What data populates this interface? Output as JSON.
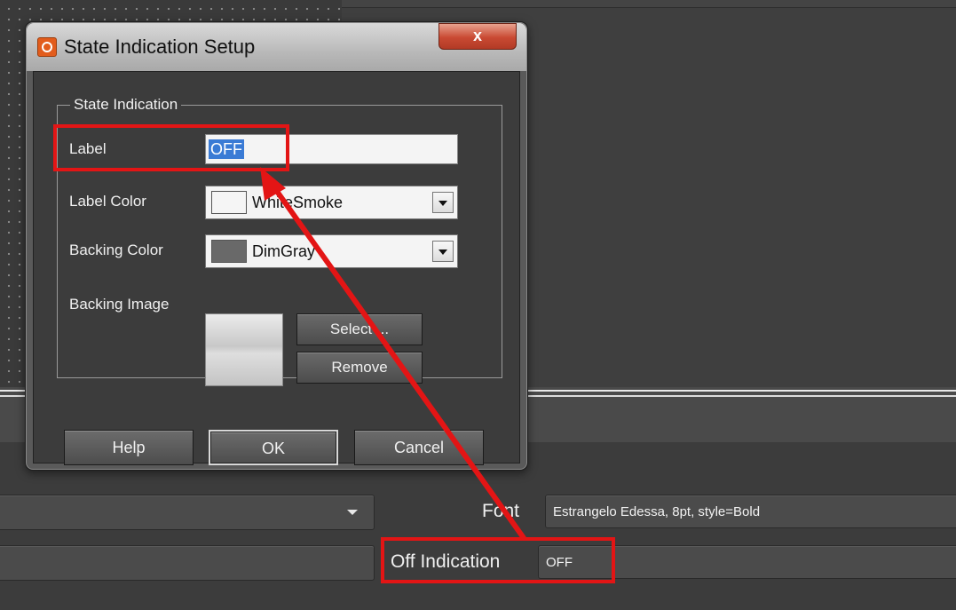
{
  "dialog": {
    "title": "State Indication Setup",
    "close_glyph": "x",
    "group_title": "State Indication",
    "label_field": {
      "label": "Label",
      "value": "OFF"
    },
    "label_color": {
      "label": "Label Color",
      "value": "WhiteSmoke",
      "swatch": "#f5f5f5"
    },
    "backing_color": {
      "label": "Backing Color",
      "value": "DimGray",
      "swatch": "#696969"
    },
    "backing_image": {
      "label": "Backing Image"
    },
    "select_button": "Select ...",
    "remove_button": "Remove",
    "help_button": "Help",
    "ok_button": "OK",
    "cancel_button": "Cancel"
  },
  "properties": {
    "font": {
      "label": "Font",
      "value": "Estrangelo Edessa, 8pt, style=Bold"
    },
    "off_indication": {
      "label": "Off Indication",
      "value": "OFF"
    }
  },
  "annotation": {
    "color": "#e31515"
  }
}
